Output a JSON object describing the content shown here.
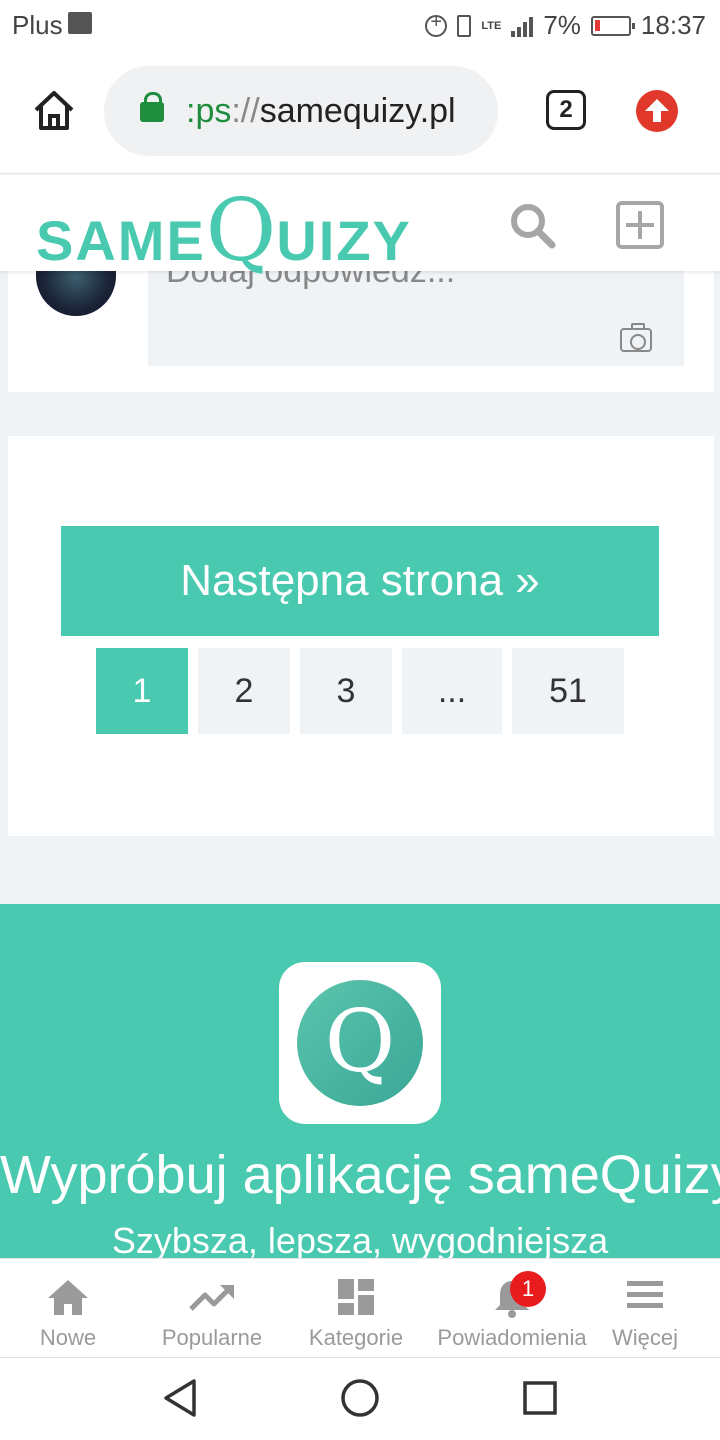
{
  "status_bar": {
    "carrier": "Plus",
    "network": "LTE",
    "battery": "7%",
    "time": "18:37"
  },
  "browser": {
    "url_scheme": ":ps",
    "url_separator": "://",
    "url_host": "samequizy.pl",
    "tab_count": "2"
  },
  "site_header": {
    "logo_small_1": "SAME",
    "logo_big": "Q",
    "logo_small_2": "UIZY",
    "accent_color": "#48c9b0"
  },
  "comment": {
    "placeholder": "Dodaj odpowiedź..."
  },
  "pagination": {
    "next_label": "Następna strona »",
    "pages": [
      {
        "label": "1",
        "active": true
      },
      {
        "label": "2",
        "active": false
      },
      {
        "label": "3",
        "active": false
      },
      {
        "label": "...",
        "active": false
      },
      {
        "label": "51",
        "active": false
      }
    ]
  },
  "promo": {
    "icon_letter": "Q",
    "title": "Wypróbuj aplikację sameQuizy",
    "subtitle": "Szybsza, lepsza, wygodniejsza"
  },
  "bottom_nav": {
    "items": [
      {
        "label": "Nowe",
        "icon": "home-icon"
      },
      {
        "label": "Popularne",
        "icon": "trending-icon"
      },
      {
        "label": "Kategorie",
        "icon": "dashboard-icon"
      },
      {
        "label": "Powiadomienia",
        "icon": "bell-icon",
        "badge": "1"
      },
      {
        "label": "Więcej",
        "icon": "menu-icon"
      }
    ]
  }
}
